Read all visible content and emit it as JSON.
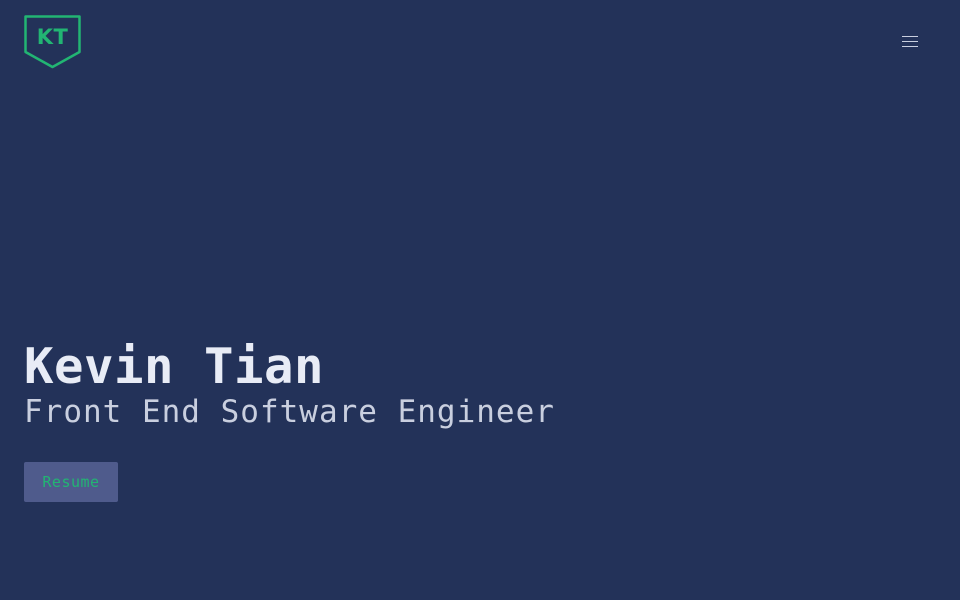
{
  "header": {
    "logo_text": "KT",
    "logo_icon": "shield-icon",
    "menu_icon": "hamburger-menu-icon"
  },
  "hero": {
    "name": "Kevin Tian",
    "role": "Front End Software Engineer",
    "resume_label": "Resume"
  },
  "colors": {
    "background": "#233259",
    "accent": "#22b573",
    "heading": "#e8ecf6",
    "subheading": "#c9cfdf",
    "button_bg": "#4f5b8c"
  }
}
